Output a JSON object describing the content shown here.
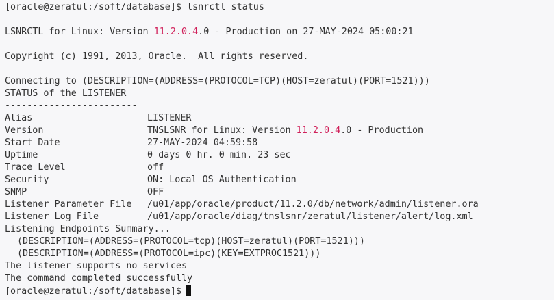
{
  "prompt": "[oracle@zeratul:/soft/database]$",
  "command": "lsnrctl status",
  "version_line": {
    "prefix": "LSNRCTL for Linux: Version ",
    "version_hl": "11.2.0.4",
    "suffix": ".0 - Production on 27-MAY-2024 05:00:21"
  },
  "copyright": "Copyright (c) 1991, 2013, Oracle.  All rights reserved.",
  "connecting": "Connecting to (DESCRIPTION=(ADDRESS=(PROTOCOL=TCP)(HOST=zeratul)(PORT=1521)))",
  "status_header": "STATUS of the LISTENER",
  "separator": "------------------------",
  "status": {
    "alias": {
      "key": "Alias",
      "value": "LISTENER"
    },
    "version": {
      "key": "Version",
      "prefix": "TNSLSNR for Linux: Version ",
      "version_hl": "11.2.0.4",
      "suffix": ".0 - Production"
    },
    "start_date": {
      "key": "Start Date",
      "value": "27-MAY-2024 04:59:58"
    },
    "uptime": {
      "key": "Uptime",
      "value": "0 days 0 hr. 0 min. 23 sec"
    },
    "trace_level": {
      "key": "Trace Level",
      "value": "off"
    },
    "security": {
      "key": "Security",
      "value": "ON: Local OS Authentication"
    },
    "snmp": {
      "key": "SNMP",
      "value": "OFF"
    },
    "param_file": {
      "key": "Listener Parameter File",
      "value": "/u01/app/oracle/product/11.2.0/db/network/admin/listener.ora"
    },
    "log_file": {
      "key": "Listener Log File",
      "value": "/u01/app/oracle/diag/tnslsnr/zeratul/listener/alert/log.xml"
    }
  },
  "endpoints_header": "Listening Endpoints Summary...",
  "endpoints": [
    "(DESCRIPTION=(ADDRESS=(PROTOCOL=tcp)(HOST=zeratul)(PORT=1521)))",
    "(DESCRIPTION=(ADDRESS=(PROTOCOL=ipc)(KEY=EXTPROC1521)))"
  ],
  "no_services": "The listener supports no services",
  "completed": "The command completed successfully",
  "final_prompt": "[oracle@zeratul:/soft/database]$"
}
